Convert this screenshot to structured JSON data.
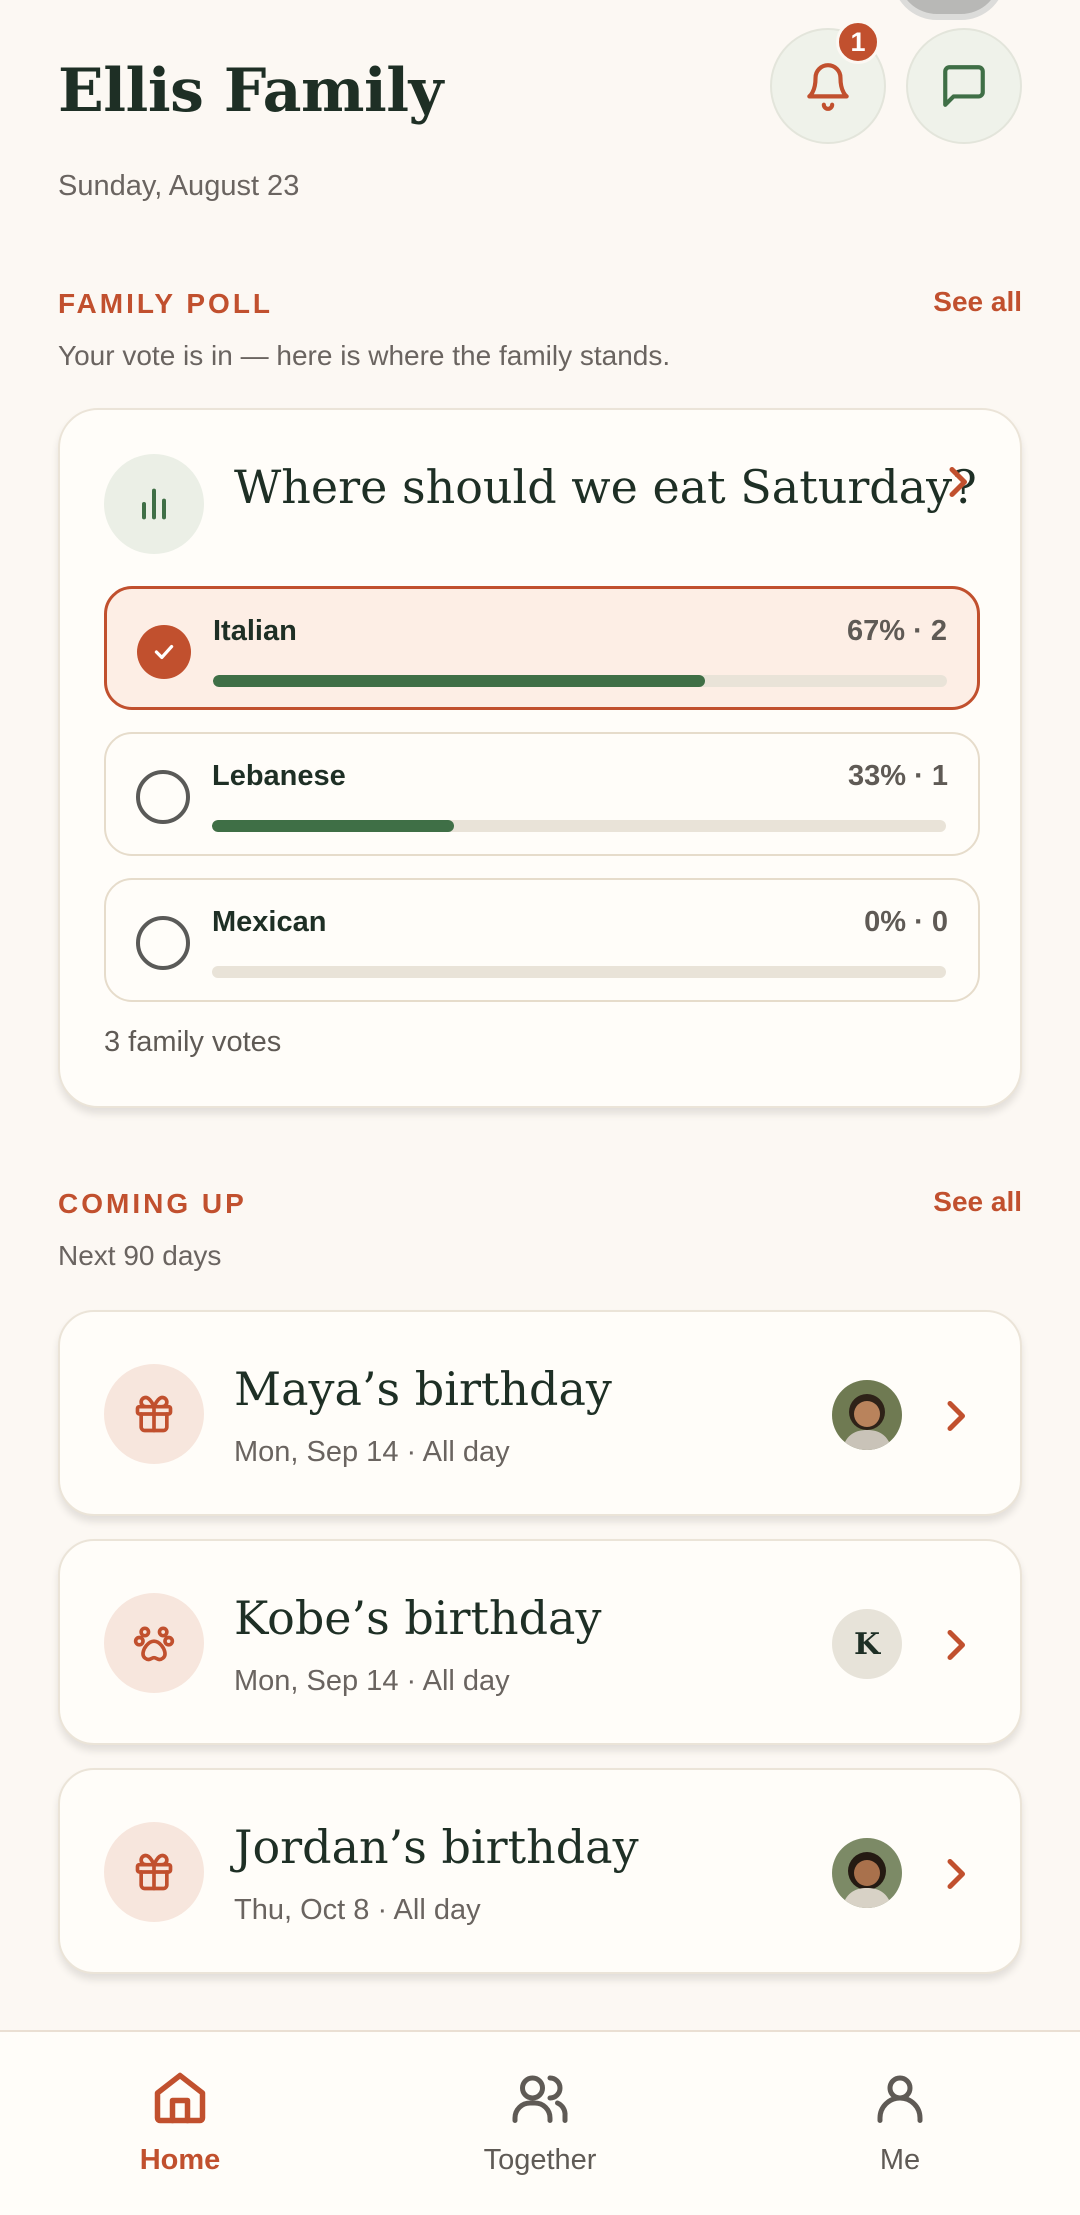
{
  "header": {
    "title": "Ellis Family",
    "date": "Sunday, August 23",
    "notification_count": "1"
  },
  "poll_section": {
    "label": "FAMILY POLL",
    "see_all": "See all",
    "subtitle": "Your vote is in — here is where the family stands.",
    "question": "Where should we eat Saturday?",
    "options": [
      {
        "label": "Italian",
        "stat": "67% · 2",
        "percent": 67,
        "selected": true
      },
      {
        "label": "Lebanese",
        "stat": "33% · 1",
        "percent": 33,
        "selected": false
      },
      {
        "label": "Mexican",
        "stat": "0% · 0",
        "percent": 0,
        "selected": false
      }
    ],
    "votes_text": "3 family votes"
  },
  "upcoming_section": {
    "label": "COMING UP",
    "see_all": "See all",
    "subtitle": "Next 90 days",
    "events": [
      {
        "title": "Maya’s birthday",
        "meta": "Mon, Sep 14 · All day",
        "icon": "gift-icon",
        "avatar": "photo"
      },
      {
        "title": "Kobe’s birthday",
        "meta": "Mon, Sep 14 · All day",
        "icon": "paw-icon",
        "avatar_letter": "K"
      },
      {
        "title": "Jordan’s birthday",
        "meta": "Thu, Oct 8 · All day",
        "icon": "gift-icon",
        "avatar": "photo"
      }
    ]
  },
  "bottom_nav": {
    "items": [
      {
        "label": "Home",
        "icon": "home-icon",
        "active": true
      },
      {
        "label": "Together",
        "icon": "people-icon",
        "active": false
      },
      {
        "label": "Me",
        "icon": "person-icon",
        "active": false
      }
    ]
  },
  "colors": {
    "accent": "#c1502e",
    "green": "#3f6f46",
    "background": "#fcf8f3",
    "text": "#1e2f25"
  }
}
